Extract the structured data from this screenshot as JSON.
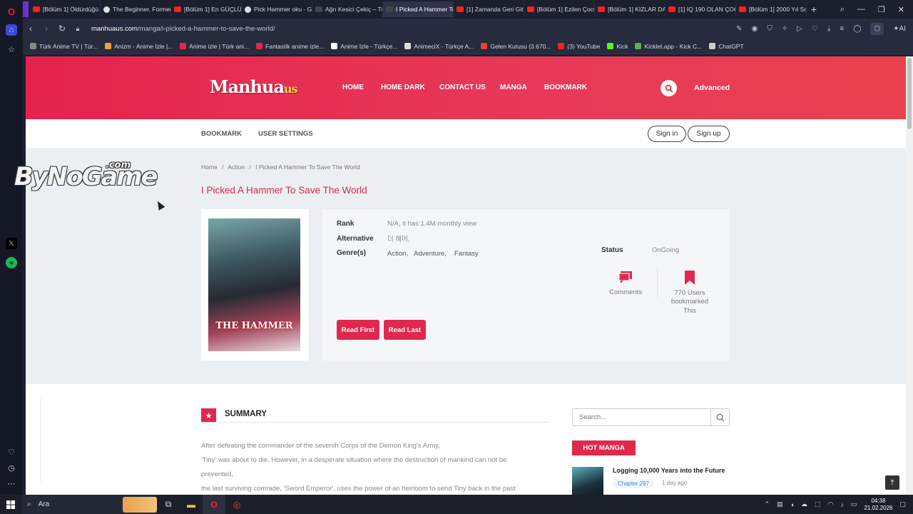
{
  "browser": {
    "tabs": [
      {
        "label": "[Bölüm 1] Öldürdüğü",
        "icon": "youtube-icon"
      },
      {
        "label": "The Beginner, Formerl",
        "icon": "globe-icon"
      },
      {
        "label": "[Bölüm 1] En GÜÇLÜ",
        "icon": "youtube-icon"
      },
      {
        "label": "Pick Hammer oku - Go",
        "icon": "globe-icon"
      },
      {
        "label": "Ağrı Kesici Çekiç – Tür",
        "icon": "site-icon"
      },
      {
        "label": "I Picked A Hammer To Sav",
        "icon": "manhuaus-icon"
      },
      {
        "label": "[1] Zamanda Geri Gitti",
        "icon": "youtube-icon"
      },
      {
        "label": "[Bölüm 1] Ezilen Çocu",
        "icon": "youtube-icon"
      },
      {
        "label": "[Bölüm 1] KIZLAR DA",
        "icon": "youtube-icon"
      },
      {
        "label": "[1] IQ 190 OLAN ÇOC",
        "icon": "youtube-icon"
      },
      {
        "label": "[Bölüm 1] 2000 Yıl Sor",
        "icon": "youtube-icon"
      }
    ],
    "active_tab_index": 5,
    "url_domain": "manhuaus.com",
    "url_path": "/manga/i-picked-a-hammer-to-save-the-world/",
    "ai_label": "AI",
    "bookmarks": [
      {
        "label": "Türk Anime TV | Tür...",
        "color": "#888888"
      },
      {
        "label": "Anizm - Anime İzle |...",
        "color": "#e8a43a"
      },
      {
        "label": "Anime izle | Türk ani...",
        "color": "#e0284f"
      },
      {
        "label": "Fantastik anime izle...",
        "color": "#e0284f"
      },
      {
        "label": "Anime İzle - Türkçe...",
        "color": "#ffffff"
      },
      {
        "label": "AnimeciX - Türkçe A...",
        "color": "#dddddd"
      },
      {
        "label": "Gelen Kutusu (3.670...",
        "color": "#ea4335"
      },
      {
        "label": "(3) YouTube",
        "color": "#ff1e1e"
      },
      {
        "label": "Kick",
        "color": "#53fc18"
      },
      {
        "label": "Kicklet.app - Kick C...",
        "color": "#6aa84f"
      },
      {
        "label": "ChatGPT",
        "color": "#cccccc"
      }
    ]
  },
  "site": {
    "logo_main": "Manhua",
    "logo_suffix": "us",
    "nav": [
      "HOME",
      "HOME DARK",
      "CONTACT US",
      "MANGA",
      "BOOKMARK"
    ],
    "advanced": "Advanced",
    "subnav": [
      "BOOKMARK",
      "USER SETTINGS"
    ],
    "sign_in": "Sign in",
    "sign_up": "Sign up",
    "breadcrumb": [
      "Home",
      "/",
      "Action",
      "/",
      "I Picked A Hammer To Save The World"
    ],
    "title": "I Picked A Hammer To Save The World",
    "cover_text": "THE HAMMER",
    "labels": {
      "rank": "Rank",
      "alternative": "Alternative",
      "genres": "Genre(s)",
      "status": "Status"
    },
    "rank_value": "N/A, it has 1.4M monthly view",
    "alternative_value": "더 해머,",
    "genres": [
      "Action,",
      "Adventure,",
      "Fantasy"
    ],
    "status_value": "OnGoing",
    "read_first": "Read First",
    "read_last": "Read Last",
    "comments": "Comments",
    "bookmark_count": "770 Users",
    "bookmark_line2": "bookmarked",
    "bookmark_line3": "This",
    "summary_title": "SUMMARY",
    "summary_lines": [
      "After defeating the commander of the seventh Corps of the Demon King's Army,",
      "'Tiny' was about to die. However, in a desperate situation where the destruction of mankind can not be",
      "prevented,",
      "the last surviving comrade, 'Sword Emperor', uses the power of an heirloom to send Tiny back in the past"
    ],
    "search_placeholder": "Search...",
    "hot_manga": "HOT MANGA",
    "hot_item_title": "Logging 10,000 Years into the Future",
    "hot_item_chapter": "Chapter 297",
    "hot_item_ago": "1 day ago",
    "accent": "#e0284f"
  },
  "watermark": {
    "main": "ByNoGame",
    "suffix": ".com"
  },
  "taskbar": {
    "search": "Ara",
    "time": "04:38",
    "date": "21.02.2026"
  }
}
